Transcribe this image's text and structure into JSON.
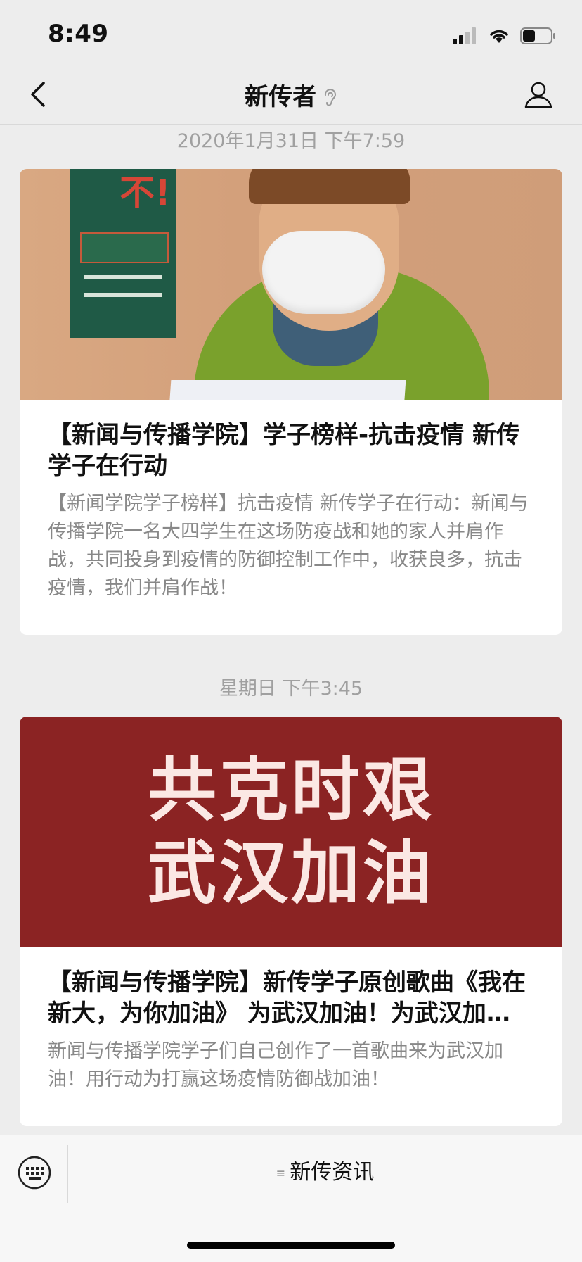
{
  "status_bar": {
    "time": "8:49",
    "battery_level": 0.45
  },
  "nav": {
    "title": "新传者"
  },
  "messages": [
    {
      "timestamp": "2020年1月31日 下午7:59",
      "title": "【新闻与传播学院】学子榜样-抗击疫情 新传学子在行动",
      "summary": "【新闻学院学子榜样】抗击疫情  新传学子在行动：新闻与传播学院一名大四学生在这场防疫战和她的家人并肩作战，共同投身到疫情的防御控制工作中，收获良多，抗击疫情，我们并肩作战！",
      "image_text": "不!"
    },
    {
      "timestamp": "星期日 下午3:45",
      "title": "【新闻与传播学院】新传学子原创歌曲《我在新大，为你加油》 为武汉加油！为武汉加油！",
      "summary": "新闻与传播学院学子们自己创作了一首歌曲来为武汉加油！用行动为打赢这场疫情防御战加油！",
      "image_lines": [
        "共克时艰",
        "武汉加油"
      ]
    }
  ],
  "tabbar": {
    "menu_label": "新传资讯"
  },
  "colors": {
    "banner_red": "#8b2323",
    "background": "#ededed"
  }
}
